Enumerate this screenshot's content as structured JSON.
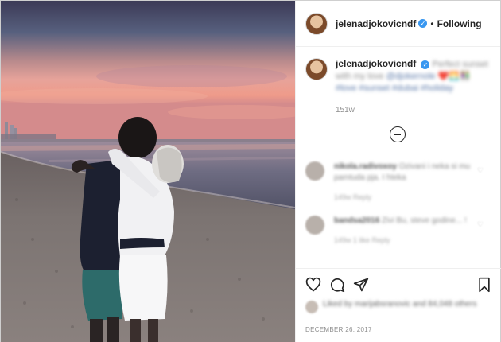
{
  "post": {
    "username": "jelenadjokovicndf",
    "verified_mark": "✓",
    "separator": "•",
    "follow_label": "Following",
    "caption_user": "jelenadjokovicndf",
    "caption_text": "Perfect sunset with my love",
    "caption_mention": "@djokernole",
    "caption_emoji": "❤️🌅👫",
    "caption_tags": "#love #sunset #dubai #holiday",
    "time_ago": "151w",
    "date": "DECEMBER 26, 2017"
  },
  "comments": [
    {
      "user": "nikola.radivoxoy",
      "text": "Ozivani i neka si mu pamtuda pja. I hteka",
      "meta": "149w   Reply"
    },
    {
      "user": "bandsa2016",
      "text": "Zivi Bu, steve godine... !",
      "meta": "149w   1 like   Reply"
    }
  ],
  "likes": {
    "text": "Liked by marijabsranovic and 84,048 others"
  },
  "icons": {
    "heart": "heart-icon",
    "comment": "comment-icon",
    "share": "share-icon",
    "save": "bookmark-icon",
    "load_more": "plus-circle-icon"
  }
}
